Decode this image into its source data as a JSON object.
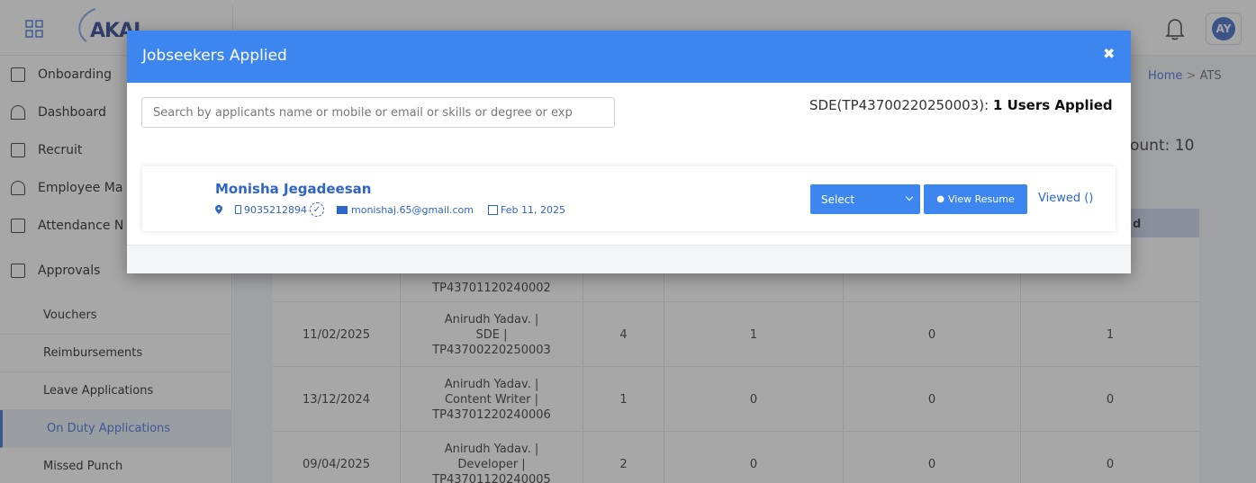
{
  "topbar": {
    "logo_text": "AKAI",
    "avatar_initials": "AY"
  },
  "sidebar": {
    "items": [
      {
        "label": "Onboarding",
        "icon": "id-card-icon"
      },
      {
        "label": "Dashboard",
        "icon": "gauge-icon"
      },
      {
        "label": "Recruit",
        "icon": "calendar-icon"
      },
      {
        "label": "Employee Ma",
        "icon": "user-icon"
      },
      {
        "label": "Attendance N",
        "icon": "calendar-icon"
      },
      {
        "label": "Approvals",
        "icon": "document-icon"
      }
    ],
    "subitems": [
      {
        "label": "Vouchers"
      },
      {
        "label": "Reimbursements"
      },
      {
        "label": "Leave Applications"
      },
      {
        "label": "On Duty Applications"
      },
      {
        "label": "Missed Punch"
      }
    ]
  },
  "breadcrumb": {
    "home": "Home",
    "sep": ">",
    "current": "ATS"
  },
  "count_label": "ount: 10",
  "table": {
    "header_partial": "d",
    "rows": [
      {
        "date": "",
        "job": "TP43701120240002",
        "c1": "",
        "c2": "",
        "c3": "",
        "c4": ""
      },
      {
        "date": "11/02/2025",
        "job": "Anirudh Yadav. | SDE | TP43700220250003",
        "c1": "4",
        "c2": "1",
        "c3": "0",
        "c4": "1"
      },
      {
        "date": "13/12/2024",
        "job": "Anirudh Yadav. | Content Writer | TP43701220240006",
        "c1": "1",
        "c2": "0",
        "c3": "0",
        "c4": "0"
      },
      {
        "date": "09/04/2025",
        "job": "Anirudh Yadav. | Developer | TP43701120240005",
        "c1": "2",
        "c2": "0",
        "c3": "0",
        "c4": "0"
      }
    ]
  },
  "modal": {
    "title": "Jobseekers Applied",
    "close": "✖",
    "search_placeholder": "Search by applicants name or mobile or email or skills or degree or exp",
    "applied_prefix": "SDE(TP43700220250003): ",
    "applied_count": "1 Users Applied",
    "applicant": {
      "name": "Monisha Jegadeesan",
      "phone": "9035212894",
      "email": "monishaj.65@gmail.com",
      "date": "Feb 11, 2025",
      "status_select": "Select",
      "view_resume": "View Resume",
      "viewed": "Viewed ()"
    }
  },
  "colors": {
    "primary": "#3d86f0",
    "link": "#2f64c8",
    "header_row": "#c9d6ea"
  }
}
